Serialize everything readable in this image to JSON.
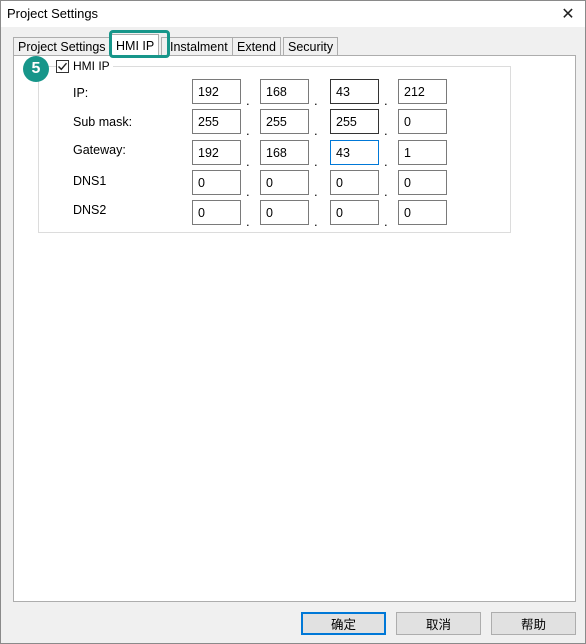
{
  "window": {
    "title": "Project Settings",
    "close_glyph": "✕"
  },
  "tabs": [
    {
      "label": "Project Settings",
      "active": false
    },
    {
      "label": "HMI IP",
      "active": true
    },
    {
      "label": "Instalment",
      "active": false
    },
    {
      "label": "Extend",
      "active": false
    },
    {
      "label": "Security",
      "active": false
    }
  ],
  "annotation": {
    "step_number": "5",
    "highlight_color": "#17968a"
  },
  "hmi_ip_group": {
    "checkbox_label": "HMI IP",
    "checked": true,
    "rows": [
      {
        "label": "IP:",
        "octets": [
          "192",
          "168",
          "43",
          "212"
        ]
      },
      {
        "label": "Sub mask:",
        "octets": [
          "255",
          "255",
          "255",
          "0"
        ]
      },
      {
        "label": "Gateway:",
        "octets": [
          "192",
          "168",
          "43",
          "1"
        ]
      },
      {
        "label": "DNS1",
        "octets": [
          "0",
          "0",
          "0",
          "0"
        ]
      },
      {
        "label": "DNS2",
        "octets": [
          "0",
          "0",
          "0",
          "0"
        ]
      }
    ],
    "separator": "."
  },
  "buttons": {
    "ok": "确定",
    "cancel": "取消",
    "help": "帮助"
  },
  "colors": {
    "accent": "#17968a",
    "focus": "#0078d7"
  }
}
